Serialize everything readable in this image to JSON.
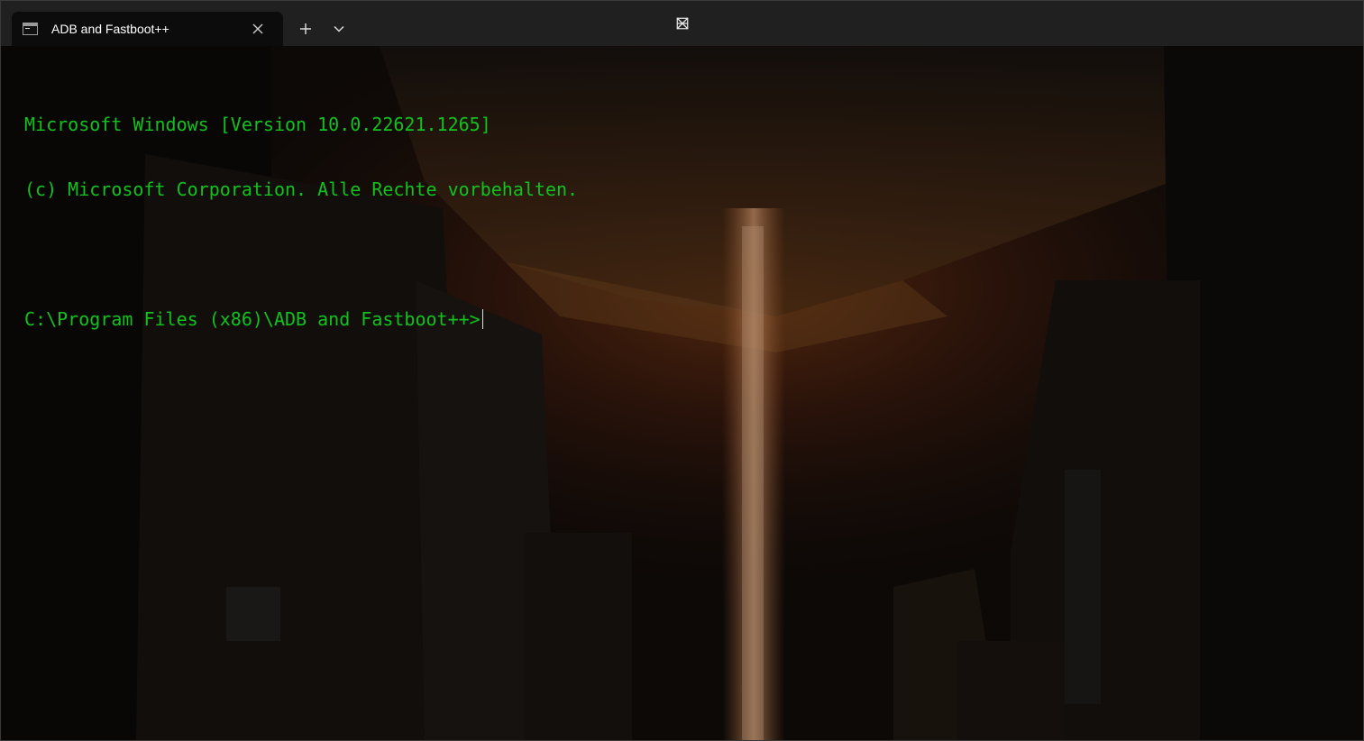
{
  "tab": {
    "title": "ADB and Fastboot++",
    "icon": "command-prompt-icon"
  },
  "titlebar": {
    "new_tab_icon": "plus-icon",
    "dropdown_icon": "chevron-down-icon",
    "minimize_icon": "minimize-icon",
    "maximize_icon": "maximize-icon",
    "close_icon": "close-icon"
  },
  "terminal": {
    "lines": [
      "Microsoft Windows [Version 10.0.22621.1265]",
      "(c) Microsoft Corporation. Alle Rechte vorbehalten.",
      ""
    ],
    "prompt": "C:\\Program Files (x86)\\ADB and Fastboot++>",
    "text_color": "#13c11e",
    "background_image": "dark sci-fi city alley with glowing orange beam"
  }
}
